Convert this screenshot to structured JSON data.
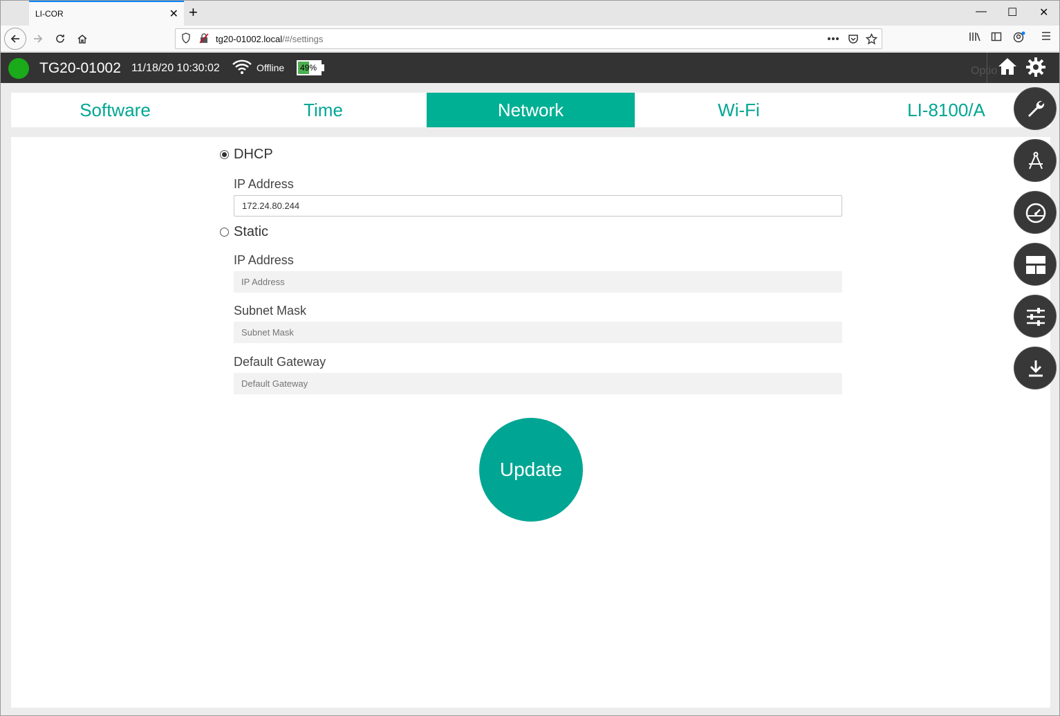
{
  "browser": {
    "tab_title": "LI-COR",
    "tab_close": "✕",
    "new_tab": "+",
    "url_host": "tg20-01002.local",
    "url_path": "/#/settings",
    "win_min": "—",
    "win_max": "☐",
    "win_close": "✕"
  },
  "app": {
    "device_name": "TG20-01002",
    "datetime": "11/18/20 10:30:02",
    "wifi_status": "Offline",
    "battery_percent": "49%",
    "battery_level": 0.49,
    "status_color": "#1aaa1a",
    "options_text": "Optio"
  },
  "tabs": [
    {
      "label": "Software",
      "active": false
    },
    {
      "label": "Time",
      "active": false
    },
    {
      "label": "Network",
      "active": true
    },
    {
      "label": "Wi-Fi",
      "active": false
    },
    {
      "label": "LI-8100/A",
      "active": false
    }
  ],
  "network": {
    "dhcp_label": "DHCP",
    "dhcp_selected": true,
    "dhcp_ip_label": "IP Address",
    "dhcp_ip_value": "172.24.80.244",
    "static_label": "Static",
    "static_selected": false,
    "static_ip_label": "IP Address",
    "static_ip_placeholder": "IP Address",
    "subnet_label": "Subnet Mask",
    "subnet_placeholder": "Subnet Mask",
    "gateway_label": "Default Gateway",
    "gateway_placeholder": "Default Gateway",
    "update_label": "Update"
  },
  "side_menu": [
    "wrench-icon",
    "compass-icon",
    "gauge-icon",
    "layout-icon",
    "sliders-icon",
    "download-icon"
  ],
  "colors": {
    "accent": "#00a693",
    "header_bg": "#333333"
  }
}
